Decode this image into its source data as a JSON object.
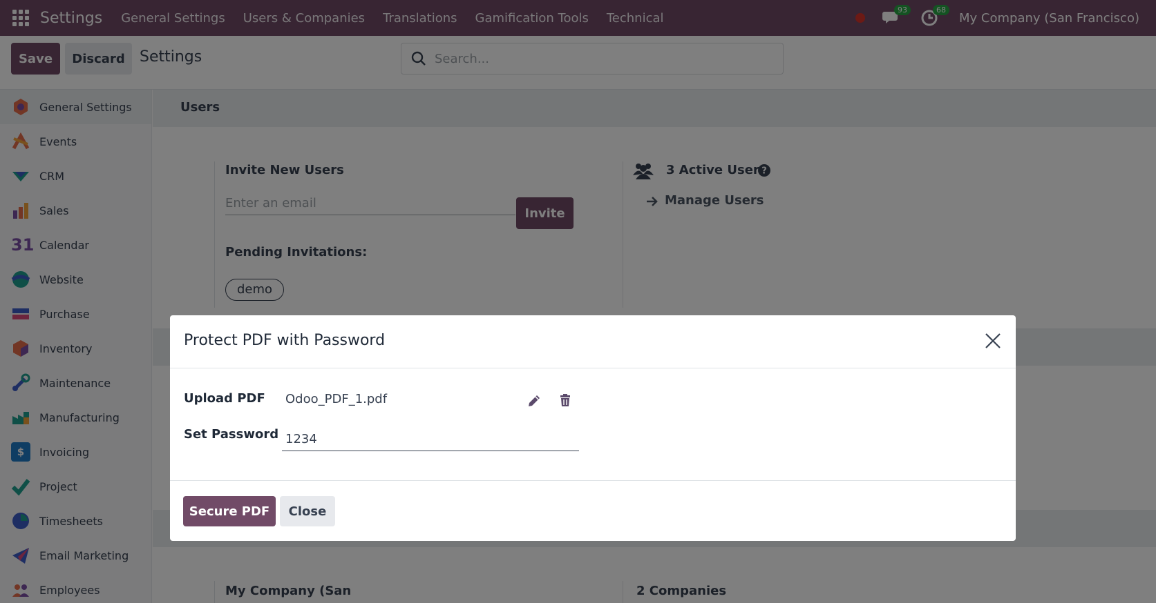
{
  "navbar": {
    "brand": "Settings",
    "menu": [
      "General Settings",
      "Users & Companies",
      "Translations",
      "Gamification Tools",
      "Technical"
    ],
    "messages_count": "93",
    "activities_count": "68",
    "company": "My Company (San Francisco)"
  },
  "control_panel": {
    "save_label": "Save",
    "discard_label": "Discard",
    "title": "Settings",
    "search_placeholder": "Search..."
  },
  "sidebar": {
    "items": [
      {
        "label": "General Settings",
        "icon": "general-settings-icon",
        "active": true
      },
      {
        "label": "Events",
        "icon": "events-icon"
      },
      {
        "label": "CRM",
        "icon": "crm-icon"
      },
      {
        "label": "Sales",
        "icon": "sales-icon"
      },
      {
        "label": "Calendar",
        "icon": "calendar-icon",
        "glyph": "31"
      },
      {
        "label": "Website",
        "icon": "website-icon"
      },
      {
        "label": "Purchase",
        "icon": "purchase-icon"
      },
      {
        "label": "Inventory",
        "icon": "inventory-icon"
      },
      {
        "label": "Maintenance",
        "icon": "maintenance-icon"
      },
      {
        "label": "Manufacturing",
        "icon": "manufacturing-icon"
      },
      {
        "label": "Invoicing",
        "icon": "invoicing-icon",
        "glyph": "$"
      },
      {
        "label": "Project",
        "icon": "project-icon"
      },
      {
        "label": "Timesheets",
        "icon": "timesheets-icon"
      },
      {
        "label": "Email Marketing",
        "icon": "email-marketing-icon"
      },
      {
        "label": "Employees",
        "icon": "employees-icon"
      }
    ]
  },
  "main": {
    "users_section_title": "Users",
    "invite_title": "Invite New Users",
    "email_placeholder": "Enter an email",
    "invite_label": "Invite",
    "pending_title": "Pending Invitations:",
    "pending_tag": "demo",
    "active_users": "3 Active Users",
    "manage_users": "Manage Users",
    "company_block": "My Company (San",
    "companies_count": "2 Companies"
  },
  "modal": {
    "title": "Protect PDF with Password",
    "upload_label": "Upload PDF",
    "file_name": "Odoo_PDF_1.pdf",
    "password_label": "Set Password",
    "password_value": "1234",
    "secure_label": "Secure PDF",
    "close_label": "Close"
  },
  "colors": {
    "brand": "#714b67",
    "badge": "#28a745",
    "alert": "#d9342b"
  }
}
